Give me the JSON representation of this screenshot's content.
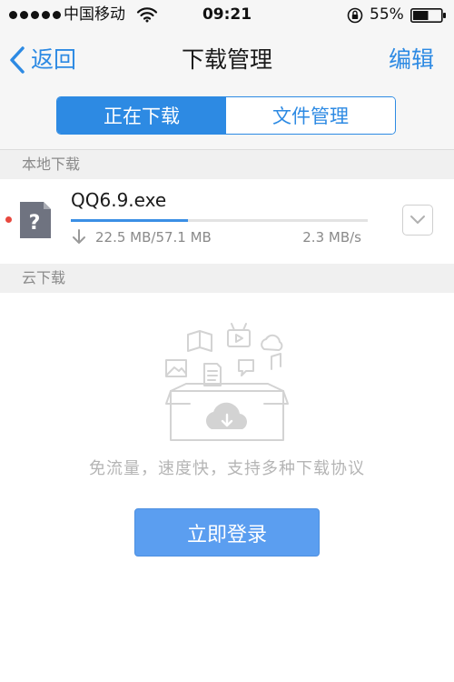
{
  "status_bar": {
    "carrier": "中国移动",
    "time": "09:21",
    "battery": "55%",
    "battery_level": 0.55,
    "signal_bars": 5,
    "wifi_icon": "wifi-icon",
    "lock_icon": "rotation-lock-icon"
  },
  "nav": {
    "back_label": "返回",
    "title": "下载管理",
    "edit_label": "编辑"
  },
  "tabs": [
    {
      "label": "正在下载",
      "active": true
    },
    {
      "label": "文件管理",
      "active": false
    }
  ],
  "local_section": {
    "title": "本地下载",
    "items": [
      {
        "name": "QQ6.9.exe",
        "size_text": "22.5 MB/57.1 MB",
        "speed": "2.3 MB/s",
        "progress": 0.394,
        "unread": true,
        "icon": "unknown-file-icon"
      }
    ]
  },
  "cloud_section": {
    "title": "云下载",
    "promo_text": "免流量，速度快，支持多种下载协议",
    "login_label": "立即登录",
    "illustration_icon": "cloud-box-illustration"
  },
  "colors": {
    "accent": "#2d8ae3",
    "login_button": "#5b9ef0",
    "unread_dot": "#e8483e"
  }
}
